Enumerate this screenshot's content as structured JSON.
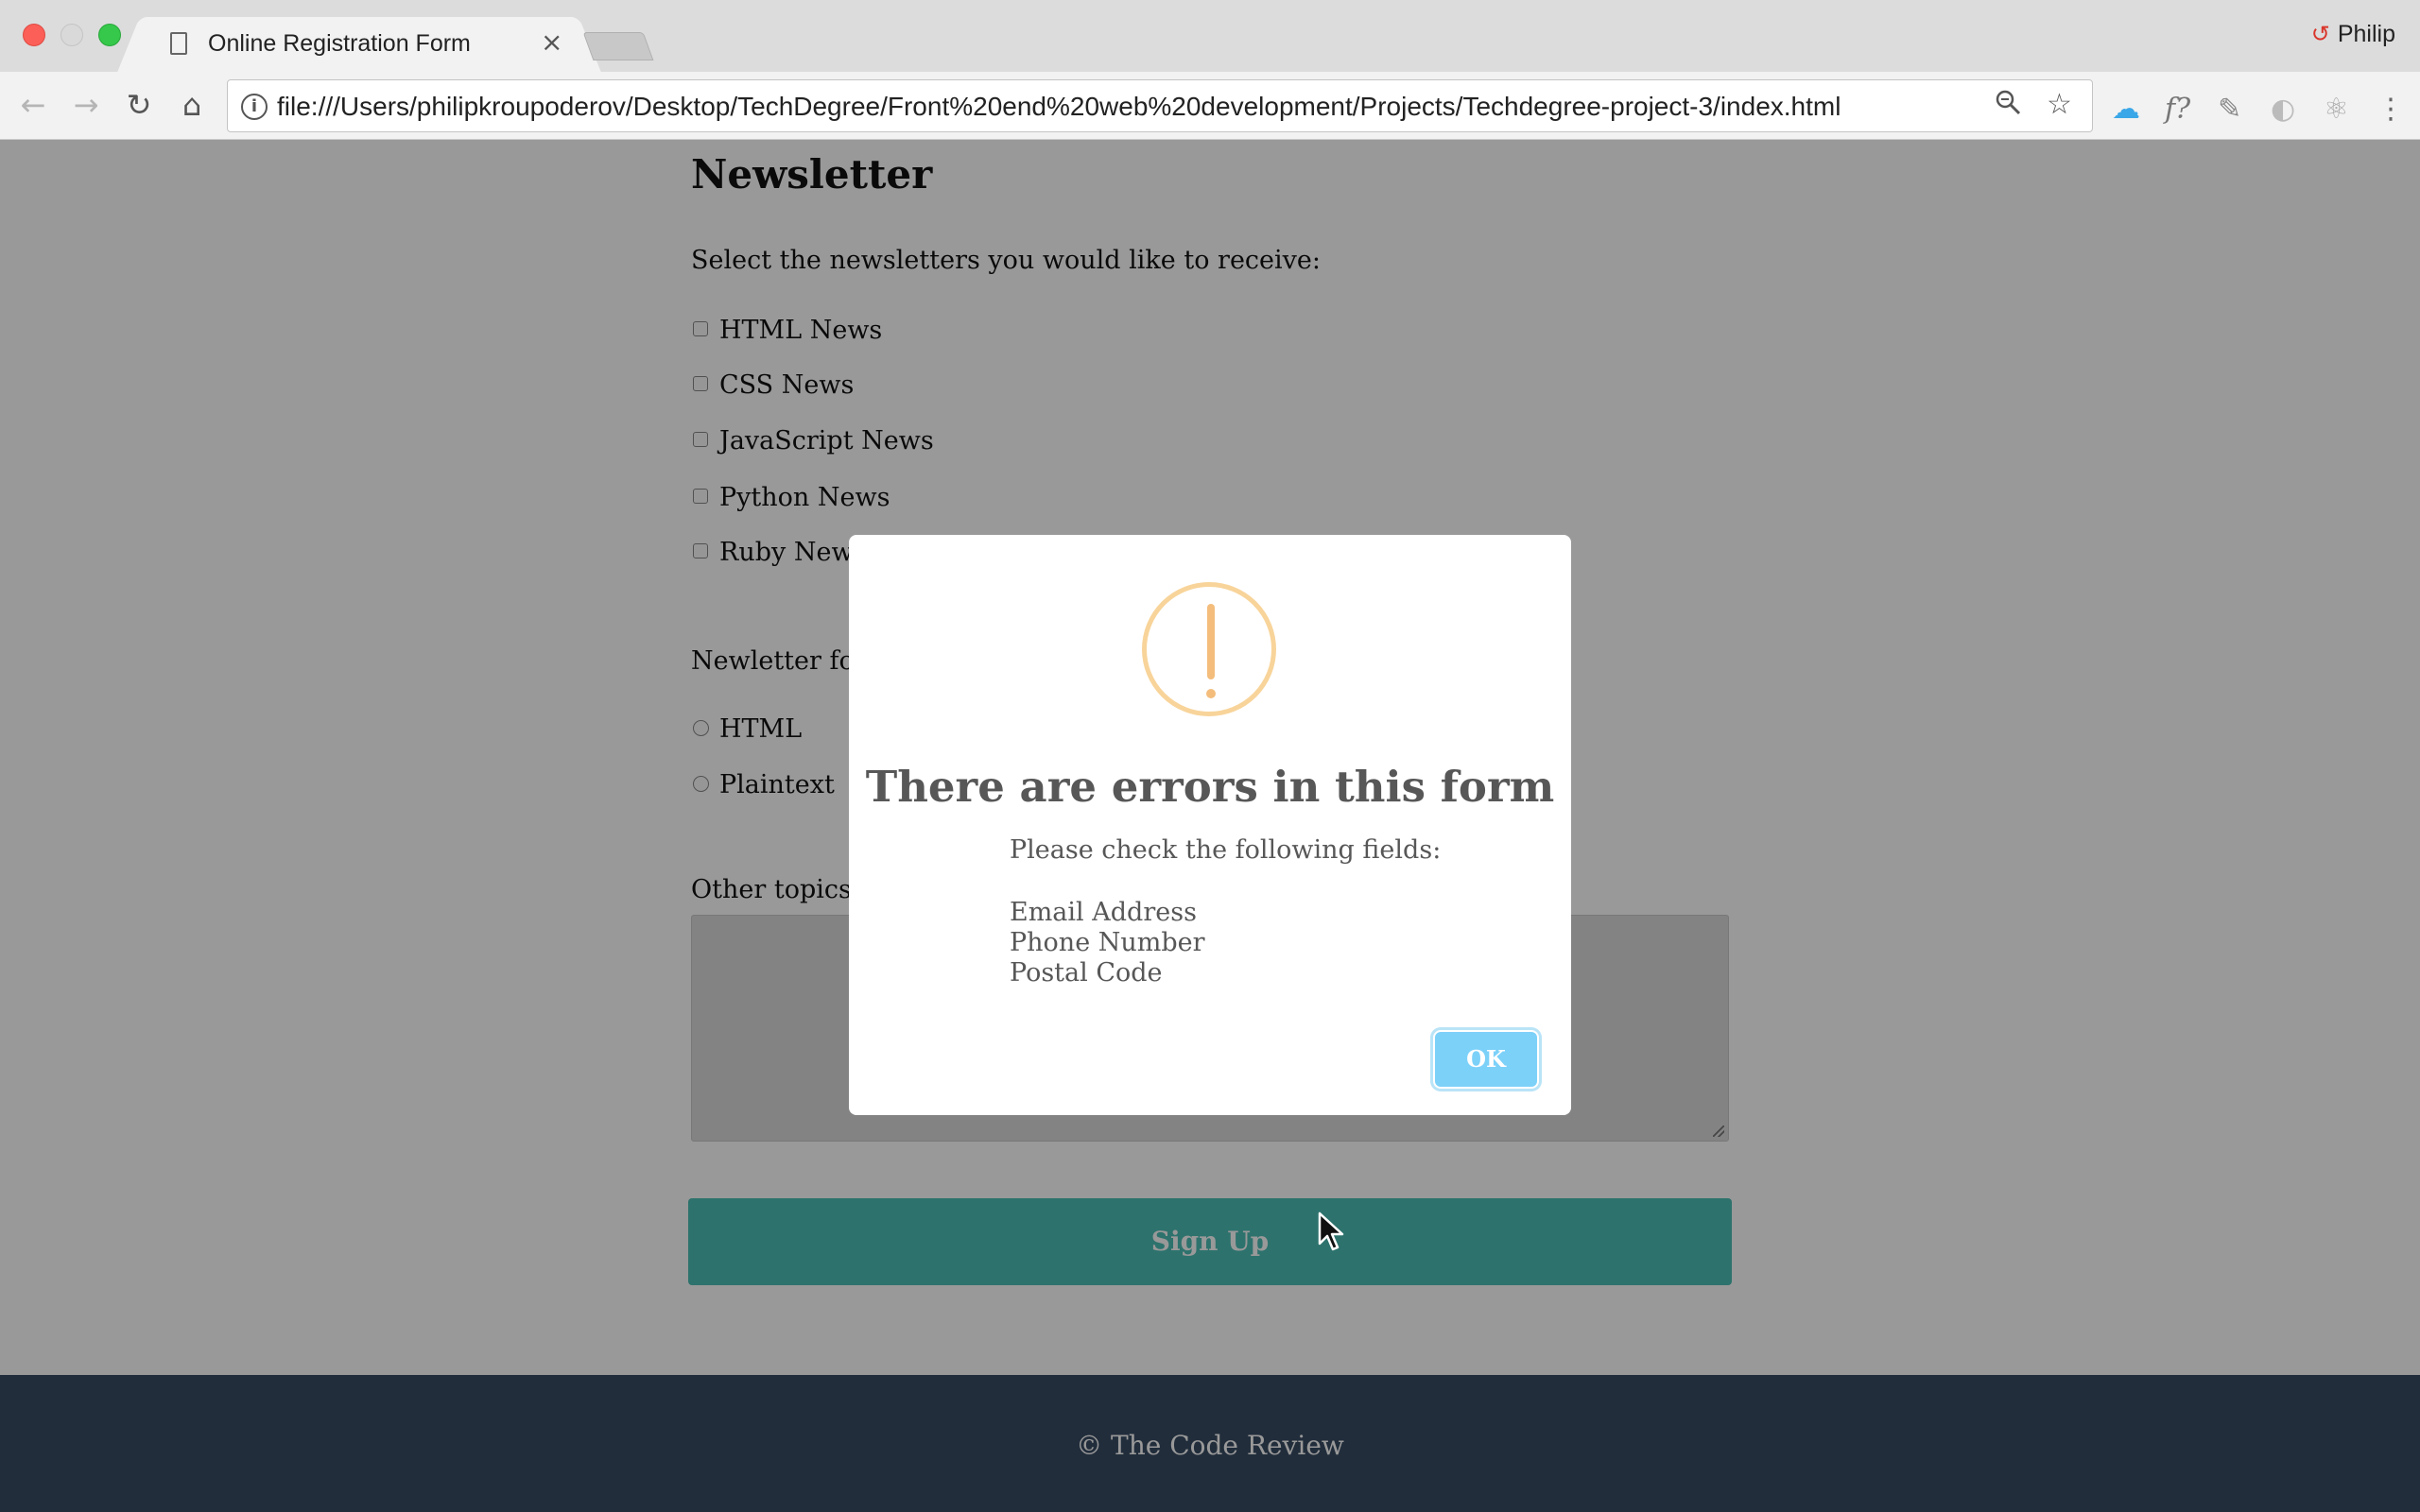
{
  "browser": {
    "tab_title": "Online Registration Form",
    "tab_close": "×",
    "url": "file:///Users/philipkroupoderov/Desktop/TechDegree/Front%20end%20web%20development/Projects/Techdegree-project-3/index.html",
    "profile_name": "Philip",
    "icons": {
      "back": "←",
      "forward": "→",
      "reload": "↻",
      "home": "⌂",
      "info": "i",
      "zoom": "🔍︎",
      "star": "☆",
      "cloud": "☁",
      "font": "f?",
      "pen": "✎",
      "ball": "◐",
      "react": "⚛",
      "menu": "⋮",
      "profile": "↺"
    }
  },
  "form": {
    "section_title": "Newsletter",
    "lead": "Select the newsletters you would like to receive:",
    "newsletters": [
      {
        "label": "HTML News",
        "checked": false
      },
      {
        "label": "CSS News",
        "checked": false
      },
      {
        "label": "JavaScript News",
        "checked": false
      },
      {
        "label": "Python News",
        "checked": false
      },
      {
        "label": "Ruby News",
        "checked": false
      }
    ],
    "format_label": "Newletter for",
    "formats": [
      {
        "label": "HTML",
        "selected": false
      },
      {
        "label": "Plaintext",
        "selected": false
      }
    ],
    "topics_label": "Other topics y",
    "topics_value": "",
    "submit_label": "Sign Up"
  },
  "footer": {
    "text": "© The Code Review"
  },
  "modal": {
    "title": "There are errors in this form",
    "text": "Please check the following fields:",
    "fields": [
      "Email Address",
      "Phone Number",
      "Postal Code"
    ],
    "ok_label": "OK",
    "icon": "warning-icon"
  },
  "colors": {
    "signup": "#4bbfb6",
    "footer": "#384b63",
    "ok_button": "#7cd1f9",
    "warning": "#f8d49a"
  }
}
